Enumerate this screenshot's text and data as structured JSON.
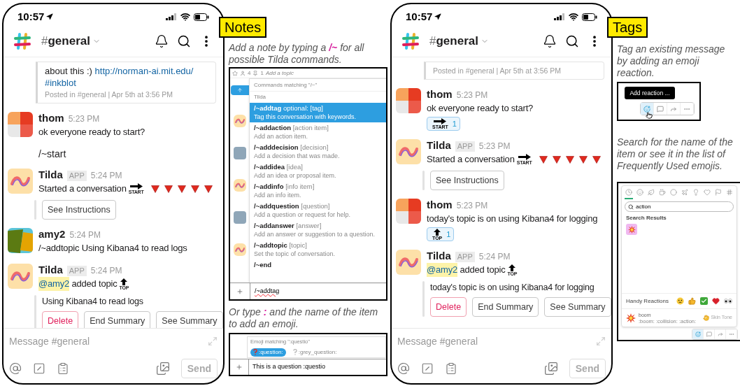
{
  "phones": [
    {
      "status_bar": {
        "time": "10:57"
      },
      "header": {
        "channel_prefix": "#",
        "channel": "general"
      },
      "messages": [
        {
          "kind": "shared_post",
          "text": "about this :) ",
          "link": "http://norman-ai.mit.edu/",
          "hashtag": "#inkblot",
          "footer": "Posted in #general | Apr 5th at 3:56 PM"
        },
        {
          "kind": "message",
          "avatar": {
            "kind": "thom"
          },
          "author": "thom",
          "time": "5:23 PM",
          "text": "ok everyone ready to start?"
        },
        {
          "kind": "continuation",
          "text": "/~start"
        },
        {
          "kind": "message",
          "avatar": {
            "kind": "tilda"
          },
          "author": "Tilda",
          "app_label": "APP",
          "time": "5:24 PM",
          "text": "Started a conversation",
          "emoji": [
            {
              "kind": "start",
              "label": "START"
            },
            {
              "kind": "triangle"
            },
            {
              "kind": "triangle"
            },
            {
              "kind": "triangle"
            },
            {
              "kind": "triangle"
            },
            {
              "kind": "triangle"
            }
          ],
          "attachment": {
            "buttons": [
              {
                "label": "See Instructions",
                "kind": "default"
              }
            ]
          }
        },
        {
          "kind": "message",
          "avatar": {
            "kind": "amy"
          },
          "author": "amy2",
          "time": "5:24 PM",
          "text": "/~addtopic Using Kibana4 to read logs"
        },
        {
          "kind": "message",
          "avatar": {
            "kind": "tilda"
          },
          "author": "Tilda",
          "app_label": "APP",
          "time": "5:24 PM",
          "mention": "@amy2",
          "text": " added topic",
          "emoji": [
            {
              "kind": "top",
              "label": "TOP"
            }
          ],
          "attachment": {
            "text": "Using Kibana4 to read logs",
            "buttons": [
              {
                "label": "Delete",
                "kind": "danger"
              },
              {
                "label": "End Summary",
                "kind": "default"
              },
              {
                "label": "See Summary",
                "kind": "default"
              }
            ]
          }
        }
      ],
      "composer": {
        "placeholder": "Message #general",
        "send": "Send"
      }
    },
    {
      "status_bar": {
        "time": "10:57"
      },
      "header": {
        "channel_prefix": "#",
        "channel": "general"
      },
      "messages": [
        {
          "kind": "shared_post",
          "footer": "Posted in #general | Apr 5th at 3:56 PM"
        },
        {
          "kind": "message",
          "avatar": {
            "kind": "thom"
          },
          "author": "thom",
          "time": "5:23 PM",
          "text": "ok everyone ready to start?",
          "reaction": {
            "emoji": {
              "kind": "start",
              "label": "START"
            },
            "count": "1"
          }
        },
        {
          "kind": "message",
          "avatar": {
            "kind": "tilda"
          },
          "author": "Tilda",
          "app_label": "APP",
          "time": "5:23 PM",
          "text": "Started a conversation",
          "emoji": [
            {
              "kind": "start",
              "label": "START"
            },
            {
              "kind": "triangle"
            },
            {
              "kind": "triangle"
            },
            {
              "kind": "triangle"
            },
            {
              "kind": "triangle"
            },
            {
              "kind": "triangle"
            }
          ],
          "attachment": {
            "buttons": [
              {
                "label": "See Instructions",
                "kind": "default"
              }
            ]
          }
        },
        {
          "kind": "message",
          "avatar": {
            "kind": "thom"
          },
          "author": "thom",
          "time": "5:23 PM",
          "text": "today's topic is on using Kibana4 for logging",
          "reaction": {
            "emoji": {
              "kind": "top",
              "label": "TOP"
            },
            "count": "1"
          }
        },
        {
          "kind": "message",
          "avatar": {
            "kind": "tilda"
          },
          "author": "Tilda",
          "app_label": "APP",
          "time": "5:24 PM",
          "mention": "@amy2",
          "text": " added topic",
          "emoji": [
            {
              "kind": "top",
              "label": "TOP"
            }
          ],
          "attachment": {
            "text": "today's topic is on using Kibana4 for logging",
            "buttons": [
              {
                "label": "Delete",
                "kind": "danger"
              },
              {
                "label": "End Summary",
                "kind": "default"
              },
              {
                "label": "See Summary",
                "kind": "default"
              }
            ]
          }
        }
      ],
      "composer": {
        "placeholder": "Message #general",
        "send": "Send"
      }
    }
  ],
  "notes": {
    "badge": "Notes",
    "caption": "Add a note by typing a **/~** for all possible Tilda commands.",
    "command_screenshot": {
      "topbar": {
        "members": "4",
        "pins": "1",
        "topic_placeholder": "Add a topic"
      },
      "avatars": [
        {
          "kind": "tilda"
        },
        {
          "kind": "photo"
        },
        {
          "kind": "tilda"
        },
        {
          "kind": "photo"
        },
        {
          "kind": "tilda"
        }
      ],
      "popup_title": "Commands matching \"/~\"",
      "group": "Tilda",
      "commands": [
        {
          "name": "/~addtag",
          "args": "optional: [tag]",
          "description": "Tag this conversation with keywords.",
          "selected": true
        },
        {
          "name": "/~addaction",
          "args": "[action item]",
          "description": "Add an action item.",
          "selected": false
        },
        {
          "name": "/~adddecision",
          "args": "[decision]",
          "description": "Add a decision that was made.",
          "selected": false
        },
        {
          "name": "/~addidea",
          "args": "[idea]",
          "description": "Add an idea or proposal item.",
          "selected": false
        },
        {
          "name": "/~addinfo",
          "args": "[info item]",
          "description": "Add an info item.",
          "selected": false
        },
        {
          "name": "/~addquestion",
          "args": "[question]",
          "description": "Add a question or request for help.",
          "selected": false
        },
        {
          "name": "/~addanswer",
          "args": "[answer]",
          "description": "Add an answer or suggestion to a question.",
          "selected": false
        },
        {
          "name": "/~addtopic",
          "args": "[topic]",
          "description": "Set the topic of conversation.",
          "selected": false
        },
        {
          "name": "/~end",
          "selected": false
        }
      ],
      "input": "/~addtag"
    },
    "caption2": "Or type **:** and the name of the item to add an emoji.",
    "emoji_screenshot": {
      "popup_title": "Emoji matching \":questio\"",
      "suggestions": [
        {
          "kind": "red_question",
          "name": ":question:",
          "selected": true
        },
        {
          "kind": "grey_question",
          "name": ":grey_question:",
          "selected": false
        }
      ],
      "input": "This is a question :questio"
    }
  },
  "tags": {
    "badge": "Tags",
    "caption": "Tag an existing message by adding an emoji reaction.",
    "reaction_screenshot": {
      "tooltip": "Add reaction ...",
      "actions": [
        {
          "kind": "add_reaction",
          "selected": true
        },
        {
          "kind": "reply",
          "selected": false
        },
        {
          "kind": "share",
          "selected": false
        },
        {
          "kind": "more",
          "selected": false
        }
      ]
    },
    "caption2": "Search for the name of the item or see it in the list of Frequently Used emojis.",
    "picker": {
      "categories": [
        {
          "kind": "clock",
          "selected": true
        },
        {
          "kind": "smiley",
          "selected": false
        },
        {
          "kind": "nature",
          "selected": false
        },
        {
          "kind": "food",
          "selected": false
        },
        {
          "kind": "activity",
          "selected": false
        },
        {
          "kind": "travel",
          "selected": false
        },
        {
          "kind": "objects",
          "selected": false
        },
        {
          "kind": "symbols",
          "selected": false
        },
        {
          "kind": "flags",
          "selected": false
        },
        {
          "kind": "custom",
          "selected": false
        }
      ],
      "search": "action",
      "results_title": "Search Results",
      "results": [
        {
          "kind": "boom",
          "selected": true
        }
      ],
      "handy_title": "Handy Reactions",
      "handy": [
        {
          "kind": "smile"
        },
        {
          "kind": "thumbs_up"
        },
        {
          "kind": "check"
        },
        {
          "kind": "heart"
        },
        {
          "kind": "eyes"
        }
      ],
      "preview": {
        "kind": "boom",
        "name": "boom",
        "aliases": ":boom: :collision: :action:"
      },
      "skin_tone": "Skin Tone",
      "toolbar": [
        {
          "kind": "add_reaction",
          "selected": true
        },
        {
          "kind": "reply",
          "selected": false
        },
        {
          "kind": "share",
          "selected": false
        },
        {
          "kind": "more",
          "selected": false
        }
      ]
    }
  }
}
